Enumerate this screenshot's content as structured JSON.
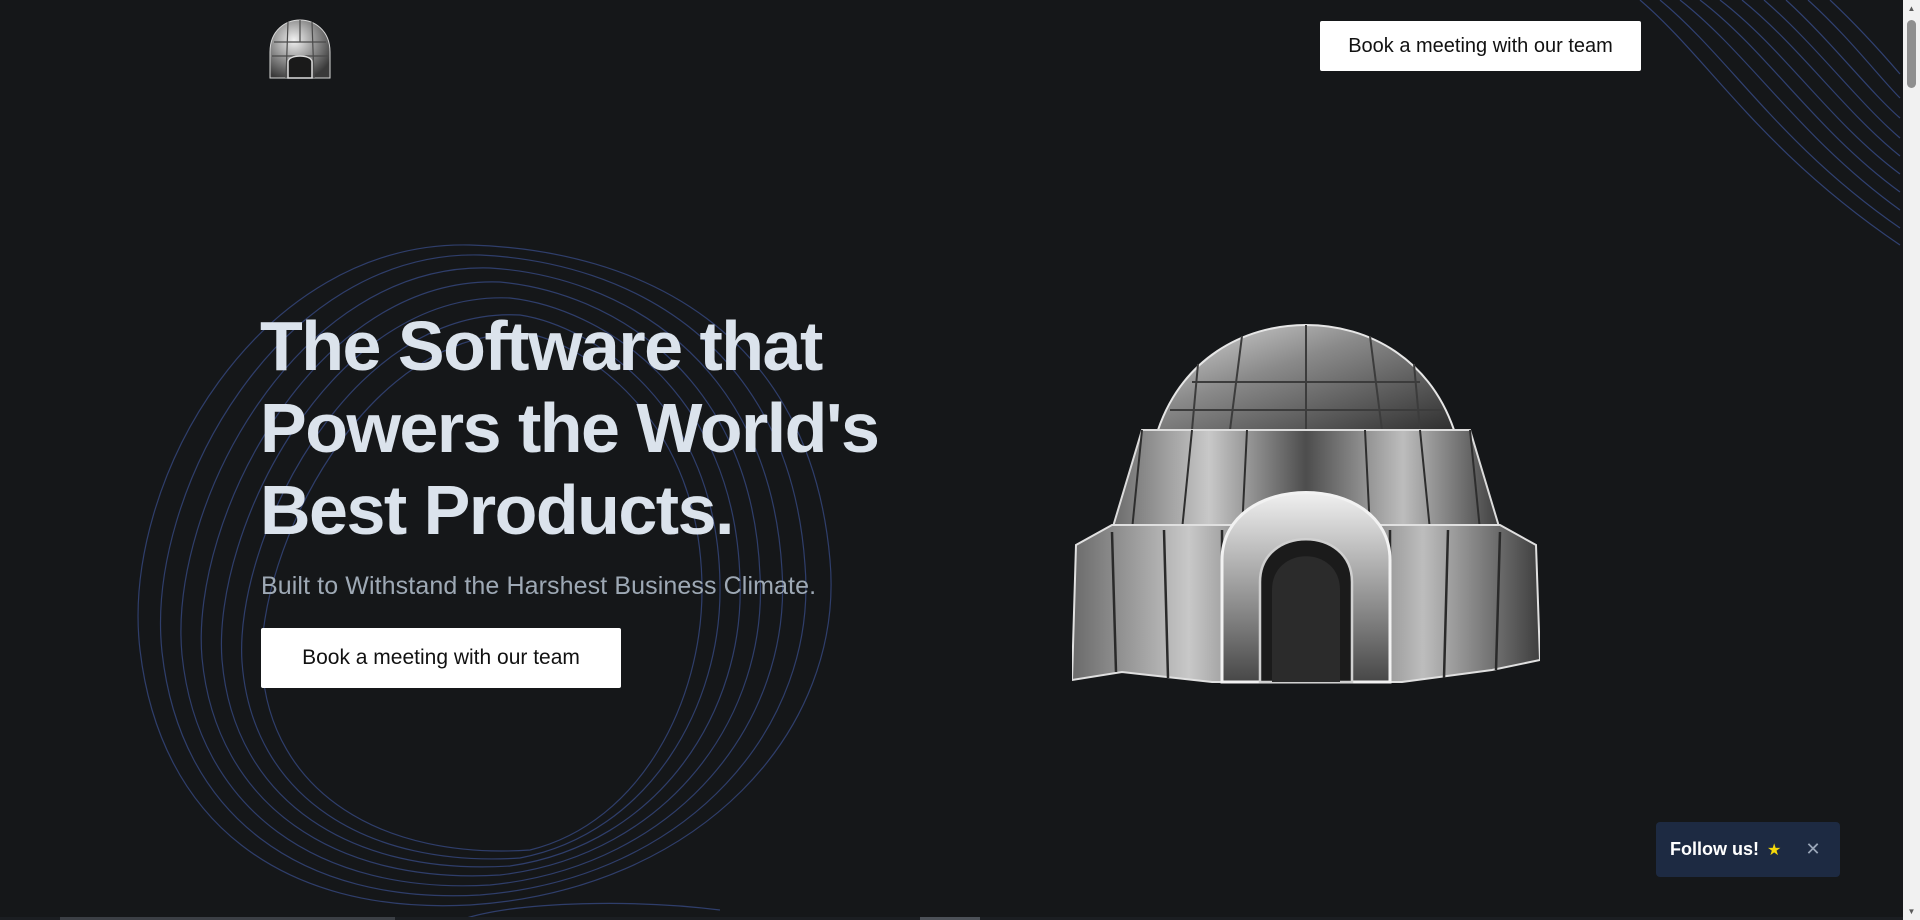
{
  "header": {
    "logo_icon": "igloo-logo-icon",
    "cta_label": "Book a meeting with our team"
  },
  "hero": {
    "title": "The Software that Powers the World's Best Products.",
    "subtitle": "Built to Withstand the Harshest Business Climate.",
    "cta_label": "Book a meeting with our team",
    "illustration_icon": "igloo-illustration"
  },
  "follow_toast": {
    "label": "Follow us!",
    "star_icon": "star-icon",
    "close_icon": "close-icon"
  },
  "colors": {
    "background": "#151719",
    "heading": "#dbe3ec",
    "subtitle": "#9ea9b5",
    "accent_lines": "#3a4f8f",
    "toast_background": "#1d2a42",
    "star": "#f5d90a"
  }
}
